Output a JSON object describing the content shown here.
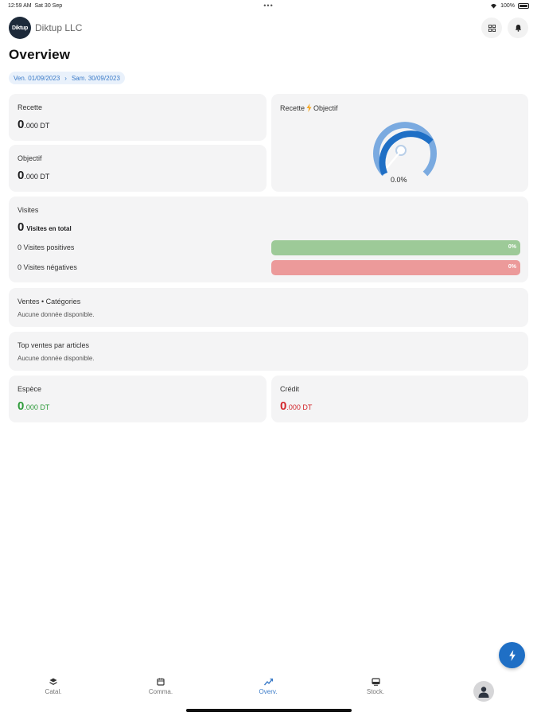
{
  "status": {
    "time": "12:59 AM",
    "date": "Sat 30 Sep",
    "dots": "•••",
    "battery": "100%"
  },
  "header": {
    "logo_text": "Diktup",
    "company": "Diktup LLC"
  },
  "page": {
    "title": "Overview",
    "date_start": "Ven. 01/09/2023",
    "date_arrow": "›",
    "date_end": "Sam. 30/09/2023"
  },
  "recette": {
    "label": "Recette",
    "int": "0",
    "dec": ".000 DT"
  },
  "objectif": {
    "label": "Objectif",
    "int": "0",
    "dec": ".000 DT"
  },
  "gauge": {
    "label_left": "Recette",
    "label_right": "Objectif",
    "percent_text": "0.0%",
    "value": 0.0
  },
  "visites": {
    "label": "Visites",
    "total": "0",
    "total_label": "Visites en total",
    "positive_label": "0 Visites positives",
    "positive_pct": "0%",
    "negative_label": "0 Visites négatives",
    "negative_pct": "0%"
  },
  "ventes_categories": {
    "title": "Ventes • Catégories",
    "empty": "Aucune donnée disponible."
  },
  "top_ventes": {
    "title": "Top ventes par articles",
    "empty": "Aucune donnée disponible."
  },
  "espece": {
    "label": "Espèce",
    "int": "0",
    "dec": ".000 DT"
  },
  "credit": {
    "label": "Crédit",
    "int": "0",
    "dec": ".000 DT"
  },
  "tabs": [
    {
      "label": "Catal."
    },
    {
      "label": "Comma."
    },
    {
      "label": "Overv."
    },
    {
      "label": "Stock."
    }
  ],
  "colors": {
    "accent": "#1f6fc5",
    "green_bar": "#9dca98",
    "red_bar": "#ec9a9a",
    "green_text": "#2e9b3a",
    "red_text": "#d3262b"
  }
}
